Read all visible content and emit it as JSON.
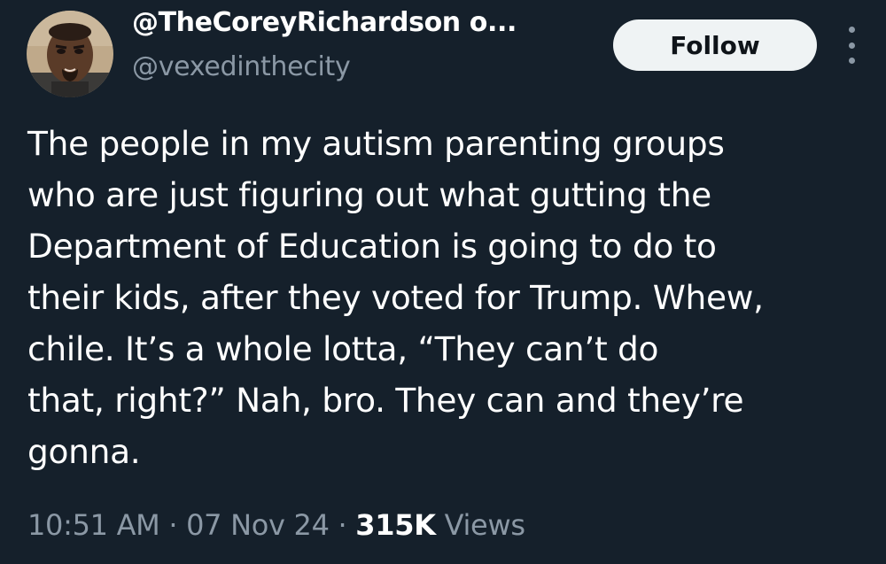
{
  "author": {
    "display_name": "@TheCoreyRichardson o...",
    "handle": "@vexedinthecity"
  },
  "actions": {
    "follow_label": "Follow",
    "more_icon": "more-vertical-icon"
  },
  "tweet": {
    "text": "The people in my autism parenting groups\nwho are just figuring out what gutting the\nDepartment of Education is going to do to\ntheir kids, after they voted for Trump. Whew,\nchile. It’s a whole lotta, “They can’t do\nthat, right?” Nah, bro. They can and they’re\ngonna.",
    "time": "10:51 AM",
    "separator": "·",
    "date": "07 Nov 24",
    "views_count": "315K",
    "views_label": "Views"
  },
  "colors": {
    "background": "#15202b",
    "text_primary": "#ffffff",
    "text_secondary": "#8b98a5",
    "button_bg": "#eff3f4"
  }
}
